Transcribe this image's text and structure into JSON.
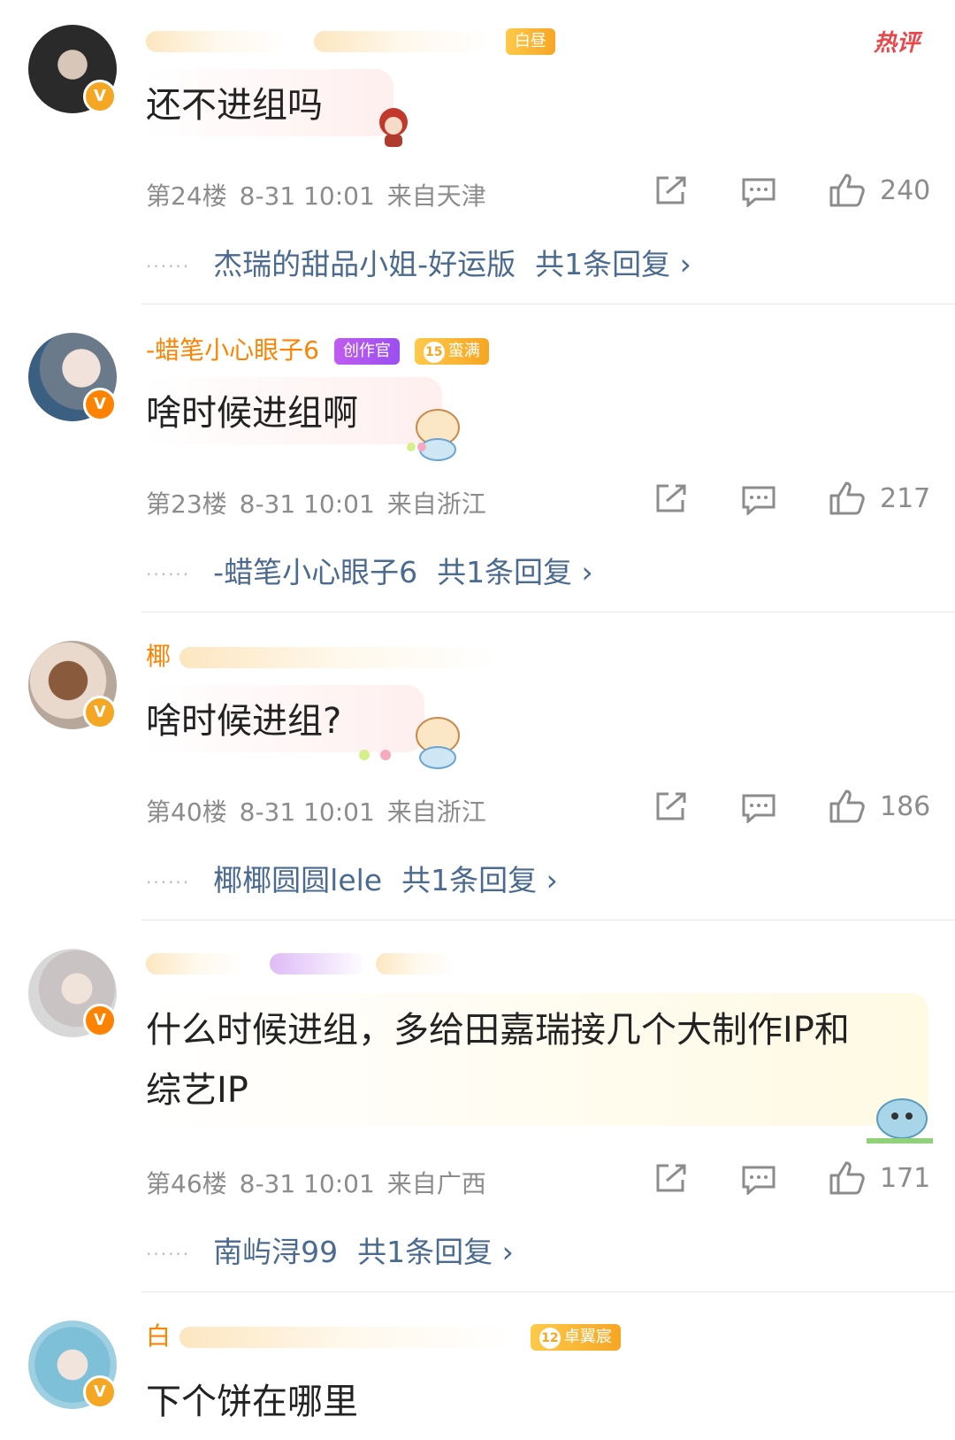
{
  "hot_tag": "热评",
  "comments": [
    {
      "username": "杰瑞的甜品小姐",
      "badges": [
        {
          "text": "白昼",
          "style": "gold"
        }
      ],
      "text": "还不进组吗",
      "floor": "第24楼",
      "date": "8-31 10:01",
      "location": "来自天津",
      "likes": "240",
      "reply_user": "杰瑞的甜品小姐-好运版",
      "reply_count": "共1条回复 ›"
    },
    {
      "username": "-蜡笔小心眼子6",
      "badges": [
        {
          "text": "创作官",
          "style": "purple"
        },
        {
          "level": "15",
          "text": "蛮满",
          "style": "gold"
        }
      ],
      "text": "啥时候进组啊",
      "floor": "第23楼",
      "date": "8-31 10:01",
      "location": "来自浙江",
      "likes": "217",
      "reply_user": "-蜡笔小心眼子6",
      "reply_count": "共1条回复 ›"
    },
    {
      "username": "椰",
      "badges": [],
      "text": "啥时候进组?",
      "floor": "第40楼",
      "date": "8-31 10:01",
      "location": "来自浙江",
      "likes": "186",
      "reply_user": "椰椰圆圆lele",
      "reply_count": "共1条回复 ›"
    },
    {
      "username": "",
      "badges": [],
      "text_line1": "什么时候进组，多给田嘉瑞接几个大制作IP和",
      "text_line2": "综艺IP",
      "floor": "第46楼",
      "date": "8-31 10:01",
      "location": "来自广西",
      "likes": "171",
      "reply_user": "南屿浔99",
      "reply_count": "共1条回复 ›"
    },
    {
      "username": "白",
      "badges": [
        {
          "level": "12",
          "text": "卓翼宸",
          "style": "gold"
        }
      ],
      "text": "下个饼在哪里"
    }
  ],
  "icons": {
    "share": "share-icon",
    "comment": "comment-icon",
    "like": "thumbs-up-icon",
    "verified": "verified-v-icon"
  },
  "colors": {
    "username": "#ff8200",
    "reply_link": "#4b6a8f",
    "meta": "#8c8c8c",
    "hot": "#e8474b"
  }
}
